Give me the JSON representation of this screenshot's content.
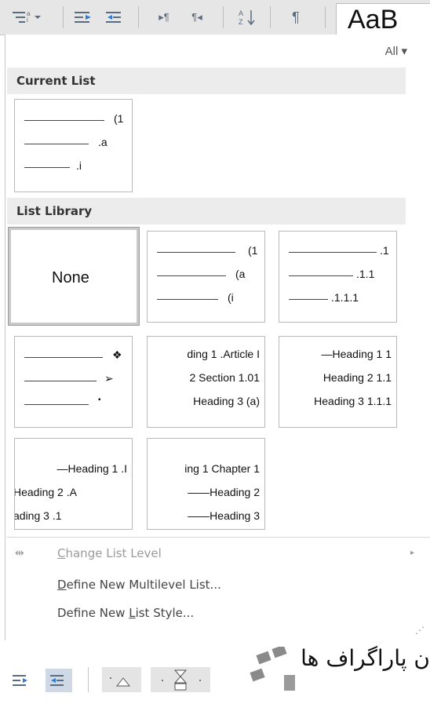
{
  "toolbar": {
    "multilevel_icon": "multilevel-list-icon",
    "decrease_indent_icon": "decrease-indent-icon",
    "increase_indent_icon": "increase-indent-icon",
    "ltr_icon": "ltr-paragraph-icon",
    "rtl_icon": "rtl-paragraph-icon",
    "sort_icon": "sort-icon",
    "pilcrow_icon": "pilcrow-icon",
    "styles_preview": "AaB"
  },
  "dropdown": {
    "filter_label": "All ▾",
    "current_list_heading": "Current List",
    "list_library_heading": "List Library",
    "current_list": {
      "l1": "(1",
      "l2": ".a",
      "l3": ".i"
    },
    "library": {
      "none_label": "None",
      "tile2": {
        "l1": "(1",
        "l2": "(a",
        "l3": "(i"
      },
      "tile3": {
        "l1": ".1",
        "l2": ".1.1",
        "l3": ".1.1.1"
      },
      "tile4": {
        "l1": "❖",
        "l2": "➢",
        "l3": "▪"
      },
      "tile5": {
        "l1": "ding 1 .Article I",
        "l2": "2 Section 1.01",
        "l3": "Heading 3 (a)"
      },
      "tile6": {
        "l1": "—Heading 1 1",
        "l2": "Heading 2 1.1",
        "l3": "Heading 3 1.1.1"
      },
      "tile7": {
        "l1": "—Heading 1 .I",
        "l2": "Heading 2 .A",
        "l3": "ading 3 .1"
      },
      "tile8": {
        "l1": "ing 1 Chapter 1",
        "l2": "——Heading 2",
        "l3": "——Heading 3"
      }
    },
    "menu": {
      "change_level_first": "C",
      "change_level_rest": "hange List Level",
      "define_multilevel_first": "D",
      "define_multilevel_rest": "efine New Multilevel List...",
      "define_style_a": "Define New ",
      "define_style_u": "L",
      "define_style_b": "ist Style..."
    }
  },
  "bottom": {
    "persian_text": "ن پاراگراف ها"
  }
}
